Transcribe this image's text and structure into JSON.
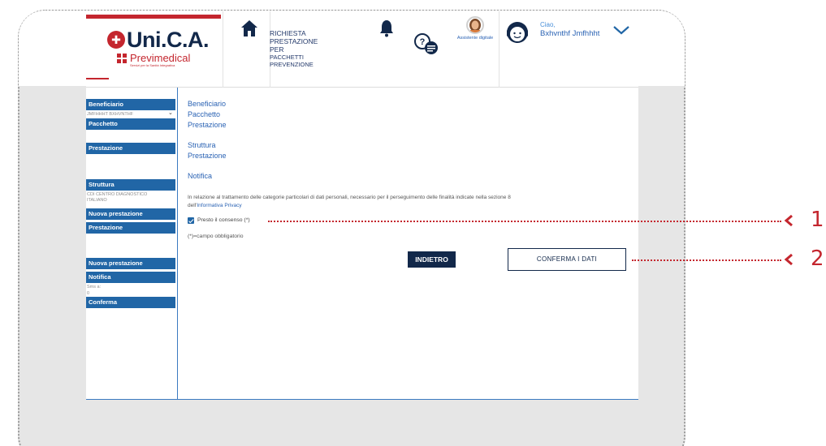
{
  "header": {
    "logo_title": "Uni.C.A.",
    "logo_subtitle": "Previmedical",
    "logo_tagline": "Servizi per la Sanità Integrativa",
    "page_title_lines": [
      "RICHIESTA",
      "PRESTAZIONE",
      "PER"
    ],
    "page_title_small": [
      "PACCHETTI",
      "PREVENZIONE"
    ],
    "assistant_label": "Assistente digitale",
    "greeting": "Ciao,",
    "user_name": "Bxhvnthf Jmfhhht"
  },
  "sidebar": {
    "beneficiario_label": "Beneficiario",
    "beneficiario_value": "JMFHHHT BXHVNTHF",
    "pacchetto_label": "Pacchetto",
    "prestazione_label": "Prestazione",
    "struttura_label": "Struttura",
    "struttura_value": "CDI CENTRO DIAGNOSTICO ITALIANO",
    "nuova_prestazione_label": "Nuova prestazione",
    "prestazione2_label": "Prestazione",
    "nuova_prestazione2_label": "Nuova prestazione",
    "notifica_label": "Notifica",
    "notifica_sms": "Sms a:",
    "notifica_value": "0",
    "conferma_label": "Conferma"
  },
  "content": {
    "links_group1": [
      "Beneficiario",
      "Pacchetto",
      "Prestazione"
    ],
    "links_group2": [
      "Struttura",
      "Prestazione"
    ],
    "link_notifica": "Notifica",
    "privacy_text": "In relazione al trattamento delle categorie particolari di dati personali, necessario per il perseguimento delle finalità indicate nella sezione 8",
    "privacy_prefix": "dell'",
    "privacy_link": "Informativa Privacy",
    "consent_label": "Presto il consenso (*)",
    "consent_checked": true,
    "required_note": "(*)=campo obbligatorio",
    "back_button": "INDIETRO",
    "confirm_button": "CONFERMA I DATI"
  },
  "callouts": {
    "first": "1",
    "second": "2"
  },
  "colors": {
    "brand_red": "#c4262e",
    "navy": "#12284a",
    "sidebar_blue": "#2166a6",
    "link_blue": "#2b63b4"
  }
}
